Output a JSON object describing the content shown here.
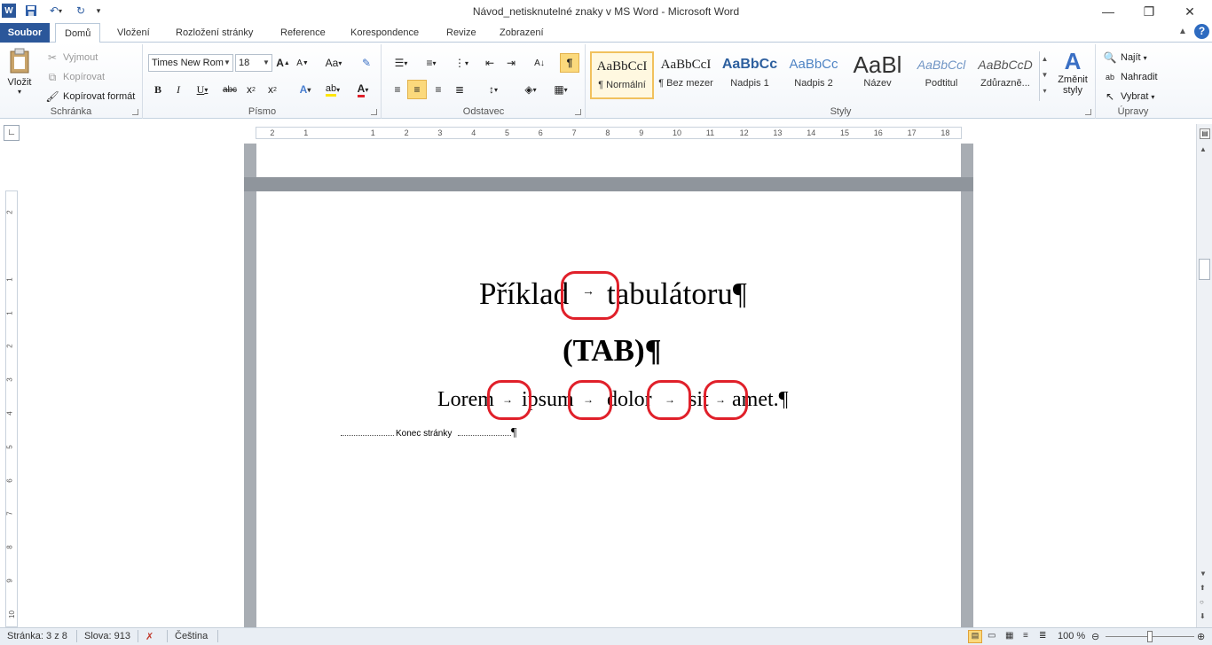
{
  "window": {
    "title": "Návod_netisknutelné znaky v MS Word - Microsoft Word"
  },
  "tabs": {
    "file": "Soubor",
    "items": [
      "Domů",
      "Vložení",
      "Rozložení stránky",
      "Reference",
      "Korespondence",
      "Revize",
      "Zobrazení"
    ]
  },
  "clipboard": {
    "paste": "Vložit",
    "cut": "Vyjmout",
    "copy": "Kopírovat",
    "format_painter": "Kopírovat formát",
    "label": "Schránka"
  },
  "font": {
    "family": "Times New Rom",
    "size": "18",
    "label": "Písmo"
  },
  "paragraph": {
    "label": "Odstavec"
  },
  "styles": {
    "items": [
      {
        "preview": "AaBbCcI",
        "name": "¶ Normální"
      },
      {
        "preview": "AaBbCcI",
        "name": "¶ Bez mezer"
      },
      {
        "preview": "AaBbCc",
        "name": "Nadpis 1"
      },
      {
        "preview": "AaBbCc",
        "name": "Nadpis 2"
      },
      {
        "preview": "AaBl",
        "name": "Název"
      },
      {
        "preview": "AaBbCcl",
        "name": "Podtitul"
      },
      {
        "preview": "AaBbCcD",
        "name": "Zdůrazně..."
      }
    ],
    "change_line1": "Změnit",
    "change_line2": "styly",
    "label": "Styly"
  },
  "editing": {
    "find": "Najít",
    "replace": "Nahradit",
    "select": "Vybrat",
    "label": "Úpravy"
  },
  "ruler": {
    "h_ticks": [
      "2",
      "1",
      "1",
      "2",
      "3",
      "4",
      "5",
      "6",
      "7",
      "8",
      "9",
      "10",
      "11",
      "12",
      "13",
      "14",
      "15",
      "16",
      "17",
      "18"
    ],
    "v_ticks": [
      "2",
      "1",
      "1",
      "2",
      "3",
      "4",
      "5",
      "6",
      "7",
      "8",
      "9",
      "10"
    ]
  },
  "document": {
    "heading_parts": [
      "Příklad",
      "tabulátoru¶"
    ],
    "tab_arrow": "→",
    "subheading": "(TAB)¶",
    "lorem_parts": [
      "Lorem",
      "ipsum",
      "dolor",
      "sit",
      "amet.¶"
    ],
    "page_break": "Konec stránky",
    "pilcrow": "¶"
  },
  "statusbar": {
    "page": "Stránka: 3 z 8",
    "words": "Slova: 913",
    "language": "Čeština",
    "zoom": "100 %"
  }
}
